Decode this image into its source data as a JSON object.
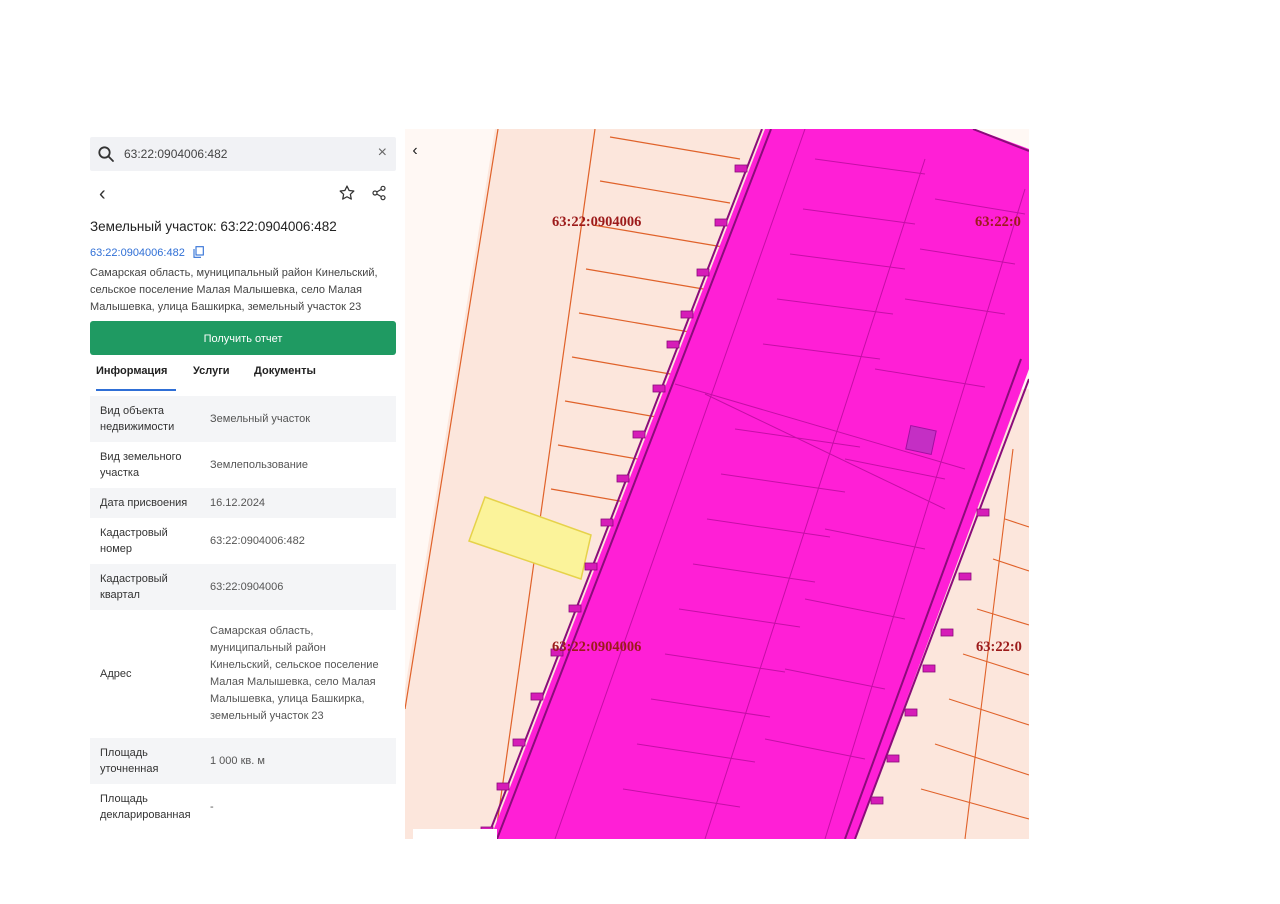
{
  "search": {
    "query": "63:22:0904006:482"
  },
  "parcel": {
    "title": "Земельный участок: 63:22:0904006:482",
    "cad_link": "63:22:0904006:482",
    "address_short": "Самарская область, муниципальный район Кинельский, сельское поселение Малая Малышевка, село Малая Малышевка, улица Башкирка, земельный участок 23",
    "report_button": "Получить отчет"
  },
  "tabs": [
    {
      "label": "Информация",
      "active": true
    },
    {
      "label": "Услуги",
      "active": false
    },
    {
      "label": "Документы",
      "active": false
    }
  ],
  "info_rows": [
    {
      "key": "Вид объекта недвижимости",
      "value": "Земельный участок"
    },
    {
      "key": "Вид земельного участка",
      "value": "Землепользование"
    },
    {
      "key": "Дата присвоения",
      "value": "16.12.2024"
    },
    {
      "key": "Кадастровый номер",
      "value": "63:22:0904006:482"
    },
    {
      "key": "Кадастровый квартал",
      "value": "63:22:0904006"
    },
    {
      "key": "Адрес",
      "value": "Самарская область, муниципальный район Кинельский, сельское поселение Малая Малышевка, село Малая Малышевка, улица Башкирка, земельный участок 23"
    },
    {
      "key": "Площадь уточненная",
      "value": "1 000 кв. м"
    },
    {
      "key": "Площадь декларированная",
      "value": "-"
    }
  ],
  "map": {
    "labels": [
      "63:22:0904006",
      "63:22:0",
      "63:22:0904006",
      "63:22:0"
    ],
    "colors": {
      "zone": "#ff1fd6",
      "parcel_fill": "#fbe0d5",
      "parcel_line": "#e0622a",
      "selected": "#fbf39a"
    }
  },
  "icons": [
    "search-icon",
    "close-icon",
    "back-icon",
    "star-icon",
    "share-icon",
    "copy-icon",
    "collapse-icon"
  ]
}
